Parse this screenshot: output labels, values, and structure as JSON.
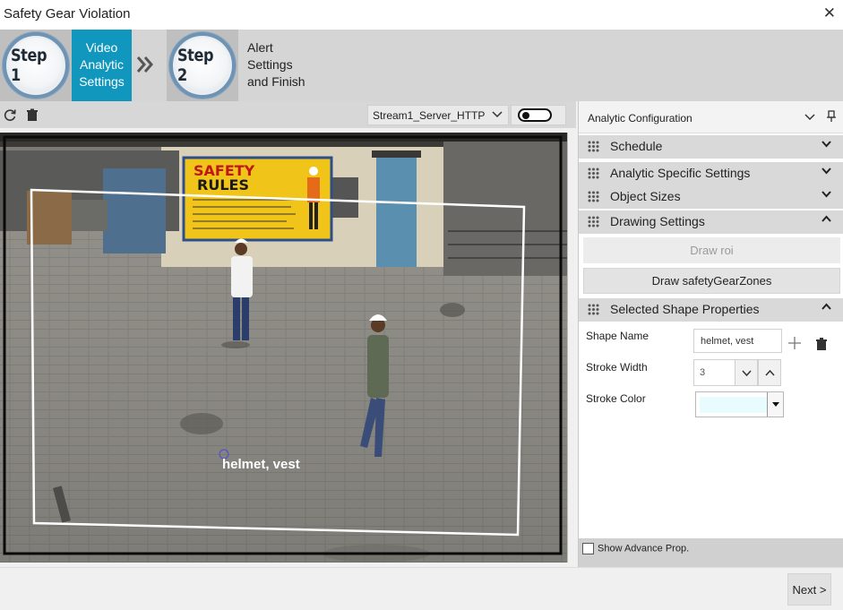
{
  "window": {
    "title": "Safety Gear Violation",
    "close_glyph": "✕"
  },
  "wizard": {
    "step1": {
      "badge": "Step 1",
      "label_lines": [
        "Video",
        "Analytic",
        "Settings"
      ],
      "active": true
    },
    "step2": {
      "badge": "Step 2",
      "label_lines": [
        "Alert",
        "Settings",
        "and Finish"
      ],
      "active": false
    },
    "separator_icon": "double-chevron-right-icon"
  },
  "toolbar": {
    "icons": [
      "refresh-icon",
      "trash-icon"
    ],
    "stream": {
      "selected": "Stream1_Server_HTTP"
    },
    "toggle": {
      "on": false
    }
  },
  "video": {
    "poster_text": [
      "SAFETY",
      "RULES"
    ],
    "zone_label": "helmet, vest"
  },
  "panel": {
    "title": "Analytic Configuration",
    "sections": {
      "schedule": "Schedule",
      "analytic_specific": "Analytic Specific Settings",
      "object_sizes": "Object Sizes",
      "drawing": "Drawing Settings",
      "selected_shape": "Selected Shape Properties"
    },
    "buttons": {
      "draw_roi": "Draw roi",
      "draw_zones": "Draw safetyGearZones"
    },
    "props": {
      "shape_name_label": "Shape Name",
      "shape_name_value": "helmet, vest",
      "stroke_width_label": "Stroke Width",
      "stroke_width_value": "3",
      "stroke_color_label": "Stroke Color",
      "stroke_color_value": "#e8fbff"
    },
    "footer": {
      "advanced_label": "Show Advance Prop.",
      "checked": false
    }
  },
  "footer": {
    "next_label": "Next >"
  },
  "colors": {
    "accent": "#1197be",
    "zone_stroke": "#ffffff"
  }
}
